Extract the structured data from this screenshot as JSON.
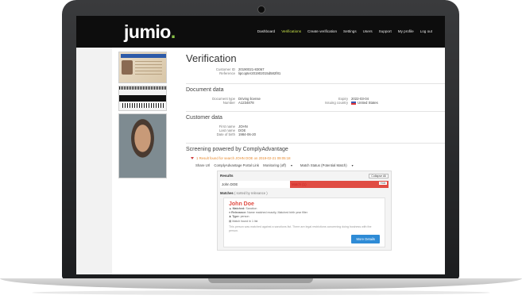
{
  "app": {
    "logo": "jumio",
    "logo_dot": "."
  },
  "nav": {
    "items": [
      {
        "label": "Dashboard",
        "active": false
      },
      {
        "label": "Verifications",
        "active": true
      },
      {
        "label": "Create verification",
        "active": false
      },
      {
        "label": "Settings",
        "active": false
      },
      {
        "label": "Users",
        "active": false
      },
      {
        "label": "Support",
        "active": false
      },
      {
        "label": "My profile",
        "active": false
      },
      {
        "label": "Log out",
        "active": false
      }
    ]
  },
  "verification": {
    "title": "Verification",
    "customer_id_label": "Customer ID",
    "customer_id": "20190021-83067",
    "reference_label": "Reference",
    "reference": "lipcopter201902015d582f81"
  },
  "document_data": {
    "title": "Document data",
    "doc_type_label": "Document type",
    "doc_type": "Driving license",
    "number_label": "Number",
    "number": "A1234878",
    "expiry_label": "Expiry",
    "expiry": "2022-03-04",
    "country_label": "Issuing country",
    "country": "United States"
  },
  "customer_data": {
    "title": "Customer data",
    "first_name_label": "First name",
    "first_name": "JOHN",
    "last_name_label": "Last name",
    "last_name": "DOE",
    "dob_label": "Date of birth",
    "dob": "1984-06-20"
  },
  "screening": {
    "title": "Screening powered by ComplyAdvantage",
    "result_text": "1 Result found for search JOHN DOE on 2019-02-21 09:05:18",
    "options": {
      "share": "Share Url",
      "portal": "ComplyAdvantage Portal Link",
      "monitoring": "Monitoring (off)",
      "match_status": "Match Status (Potential Match)"
    }
  },
  "results": {
    "title": "Results",
    "collapse_label": "Collapse All",
    "row_name": "John DOE",
    "row_match": "Match (1)",
    "hide_label": "Hide",
    "matches_label": "Matches",
    "matches_sort": "( sorted by relevance )",
    "card": {
      "name": "John Doe",
      "matched_label": "Matched:",
      "matched": "Sanction",
      "relevance_label": "Relevance:",
      "relevance": "Name matched exactly, Matched birth year filter",
      "type_label": "Type:",
      "type": "person",
      "match_found": "Match found in 1 list",
      "note": "This person was matched against a sanctions list. There are legal restrictions concerning doing business with the person.",
      "more_details": "More Details"
    }
  },
  "colors": {
    "accent": "#c8e34a",
    "match_red": "#e04c43",
    "button_blue": "#2e8bd6"
  }
}
